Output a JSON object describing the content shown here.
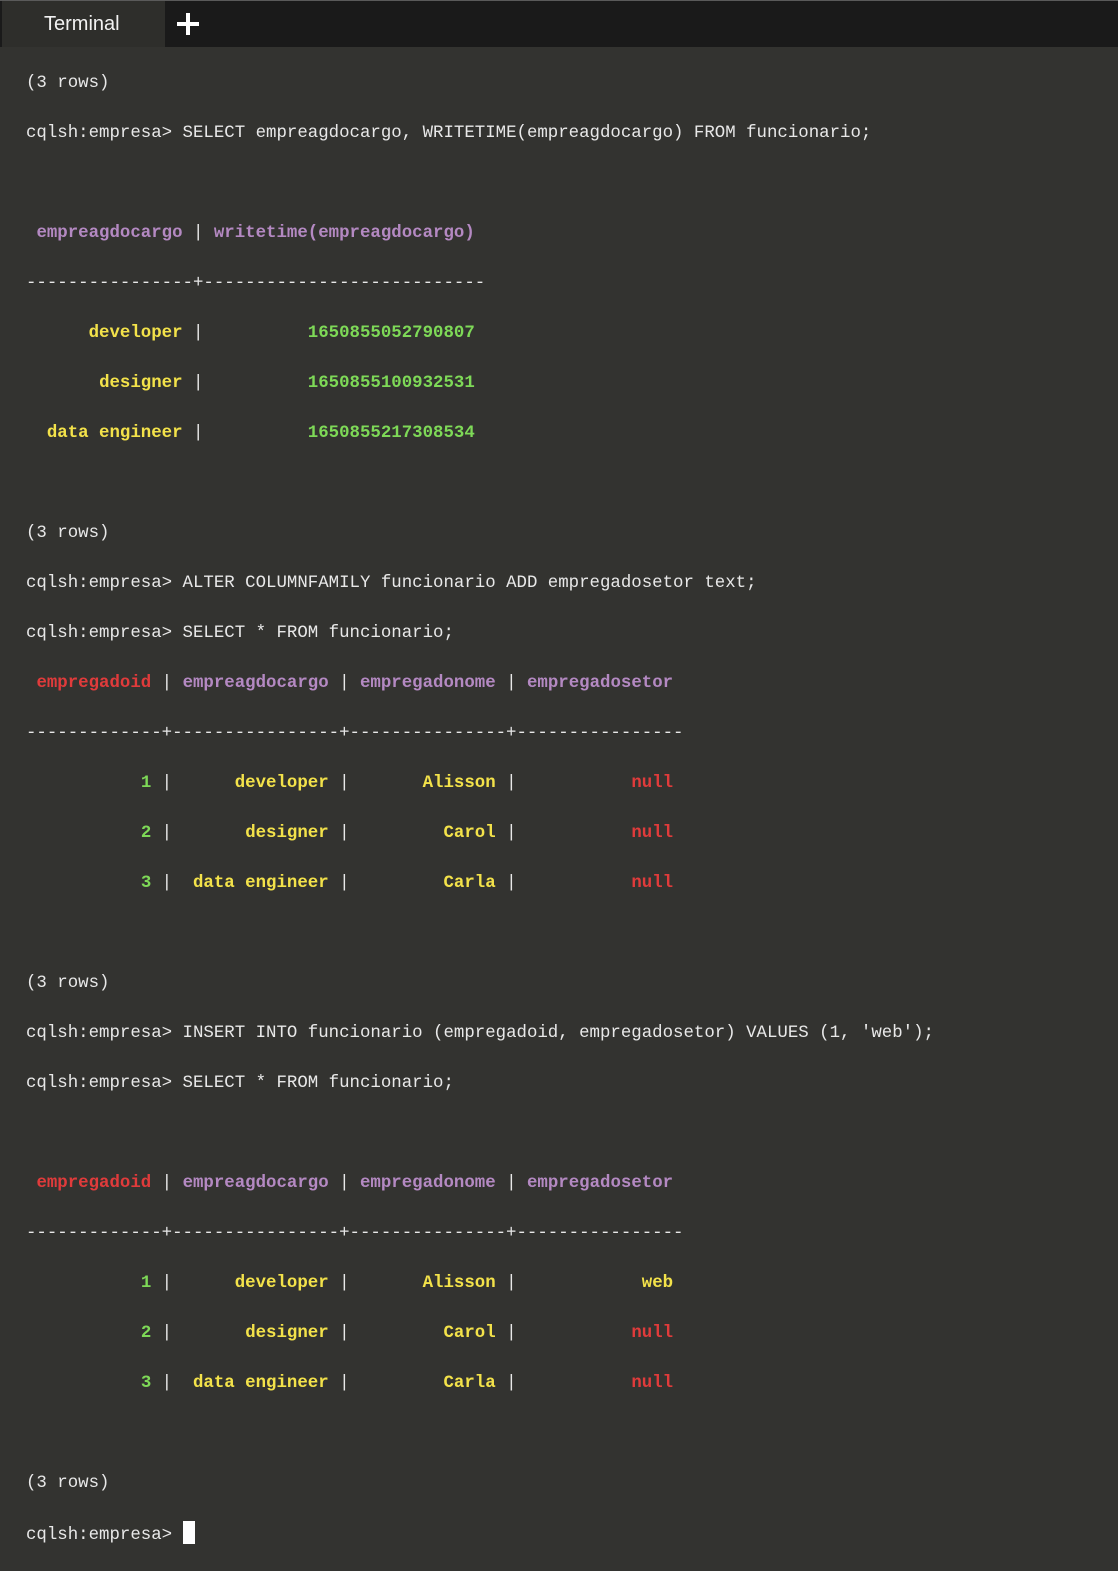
{
  "tab": {
    "title": "Terminal",
    "new_tab": "+"
  },
  "prompt": "cqlsh:empresa> ",
  "rows_msg": "(3 rows)",
  "commands": {
    "c1": "SELECT empreagdocargo, WRITETIME(empreagdocargo) FROM funcionario;",
    "c2": "ALTER COLUMNFAMILY funcionario ADD empregadosetor text;",
    "c3": "SELECT * FROM funcionario;",
    "c4": "INSERT INTO funcionario (empregadoid, empregadosetor) VALUES (1, 'web');",
    "c5": "SELECT * FROM funcionario;"
  },
  "writetime_table": {
    "headers": [
      "empreagdocargo",
      "writetime(empreagdocargo)"
    ],
    "rows": [
      [
        "developer",
        "1650855052790807"
      ],
      [
        "designer",
        "1650855100932531"
      ],
      [
        "data engineer",
        "1650855217308534"
      ]
    ]
  },
  "table1": {
    "headers": [
      "empregadoid",
      "empreagdocargo",
      "empregadonome",
      "empregadosetor"
    ],
    "rows": [
      [
        "1",
        "developer",
        "Alisson",
        "null"
      ],
      [
        "2",
        "designer",
        "Carol",
        "null"
      ],
      [
        "3",
        "data engineer",
        "Carla",
        "null"
      ]
    ]
  },
  "table2": {
    "headers": [
      "empregadoid",
      "empreagdocargo",
      "empregadonome",
      "empregadosetor"
    ],
    "rows": [
      [
        "1",
        "developer",
        "Alisson",
        "web"
      ],
      [
        "2",
        "designer",
        "Carol",
        "null"
      ],
      [
        "3",
        "data engineer",
        "Carla",
        "null"
      ]
    ]
  }
}
